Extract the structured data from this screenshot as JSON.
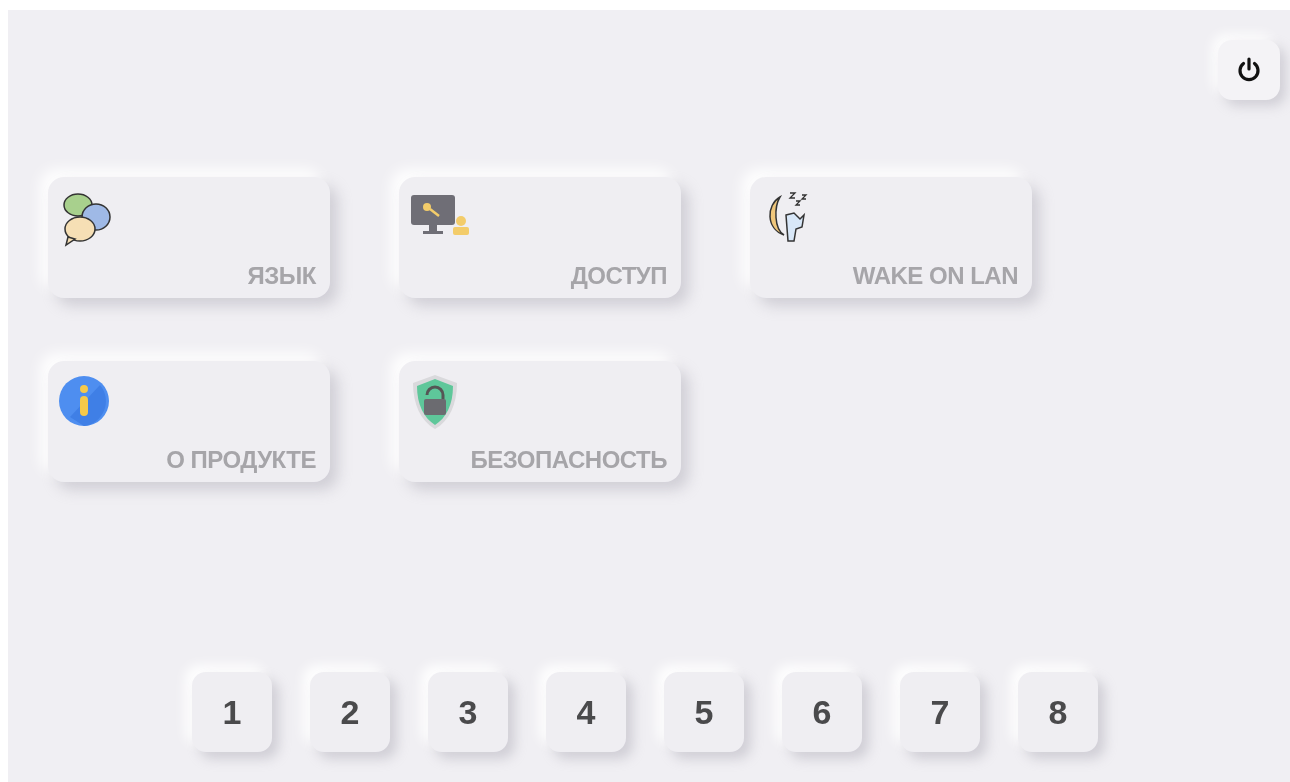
{
  "tiles": [
    {
      "label": "ЯЗЫК",
      "kind": "language"
    },
    {
      "label": "ДОСТУП",
      "kind": "access"
    },
    {
      "label": "WAKE ON LAN",
      "kind": "sleep"
    },
    {
      "label": "О ПРОДУКТЕ",
      "kind": "info"
    },
    {
      "label": "БЕЗОПАСНОСТЬ",
      "kind": "security"
    }
  ],
  "pages": [
    "1",
    "2",
    "3",
    "4",
    "5",
    "6",
    "7",
    "8"
  ]
}
